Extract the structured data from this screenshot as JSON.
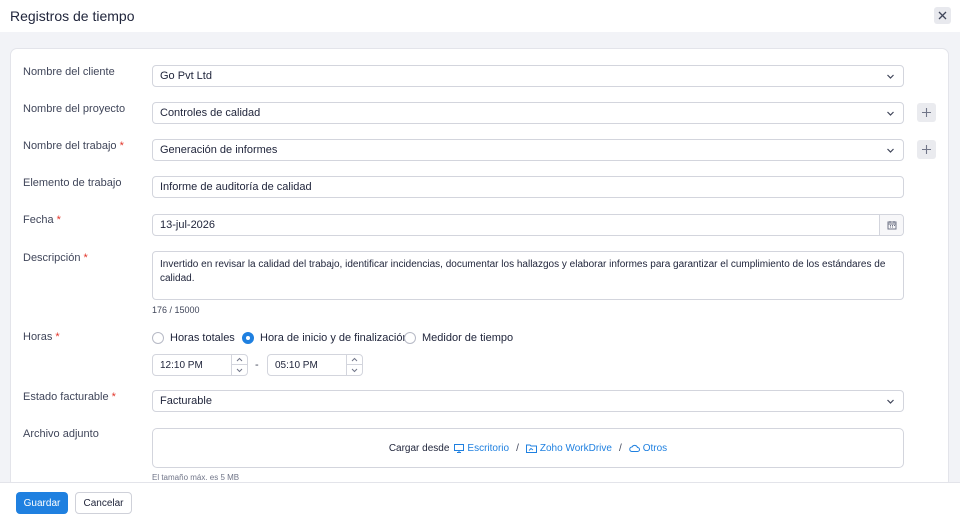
{
  "dialog": {
    "title": "Registros de tiempo"
  },
  "labels": {
    "customer": "Nombre del cliente",
    "project": "Nombre del proyecto",
    "task": "Nombre del trabajo",
    "work_item": "Elemento de trabajo",
    "date": "Fecha",
    "description": "Descripción",
    "hours": "Horas",
    "billable": "Estado facturable",
    "attachment": "Archivo adjunto"
  },
  "values": {
    "customer": "Go Pvt Ltd",
    "project": "Controles de calidad",
    "task": "Generación de informes",
    "work_item": "Informe de auditoría de calidad",
    "date": "13-jul-2026",
    "description": "Invertido en revisar la calidad del trabajo, identificar incidencias, documentar los hallazgos y elaborar informes para garantizar el cumplimiento de los estándares de calidad.",
    "char_count": "176 / 15000",
    "billable": "Facturable"
  },
  "hours_options": [
    {
      "label": "Horas totales",
      "selected": false
    },
    {
      "label": "Hora de inicio y de finalización",
      "selected": true
    },
    {
      "label": "Medidor de tiempo",
      "selected": false
    }
  ],
  "times": {
    "start": "12:10 PM",
    "end": "05:10 PM",
    "separator": "-"
  },
  "upload": {
    "prefix": "Cargar desde",
    "desktop": "Escritorio",
    "workdrive": "Zoho WorkDrive",
    "others": "Otros",
    "separator": "/",
    "max_size": "El tamaño máx. es 5 MB"
  },
  "required_mark": "*",
  "buttons": {
    "save": "Guardar",
    "cancel": "Cancelar"
  },
  "colors": {
    "accent": "#1f80e0",
    "required": "#e2352a"
  }
}
